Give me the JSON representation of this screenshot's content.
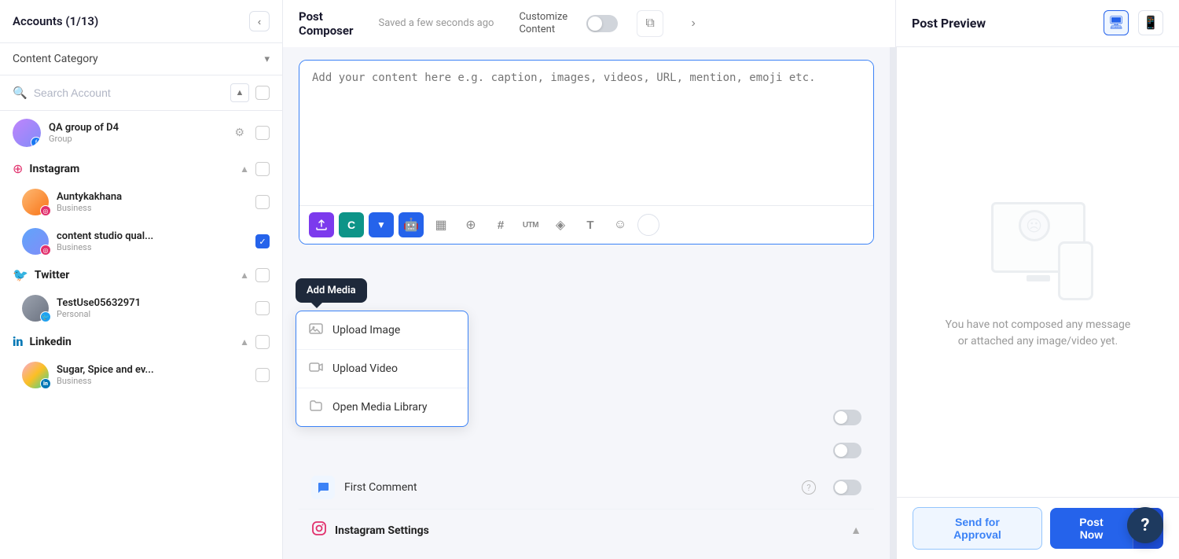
{
  "sidebar": {
    "header_title": "Accounts (1/13)",
    "collapse_icon": "‹",
    "content_category_label": "Content Category",
    "content_category_chevron": "▾",
    "search_placeholder": "Search Account",
    "accounts": [
      {
        "name": "QA group of D4",
        "type": "Group",
        "platform": "facebook",
        "checked": false
      }
    ],
    "platforms": [
      {
        "name": "Instagram",
        "icon": "instagram",
        "collapsed": false,
        "sub_accounts": [
          {
            "name": "Auntykakhana",
            "type": "Business",
            "avatar_style": "orange"
          },
          {
            "name": "content studio qual...",
            "type": "Business",
            "avatar_style": "blue",
            "checked": true
          }
        ]
      },
      {
        "name": "Twitter",
        "icon": "twitter",
        "collapsed": false,
        "sub_accounts": [
          {
            "name": "TestUse05632971",
            "type": "Personal",
            "avatar_style": "gray"
          }
        ]
      },
      {
        "name": "Linkedin",
        "icon": "linkedin",
        "collapsed": false,
        "sub_accounts": [
          {
            "name": "Sugar, Spice and ev...",
            "type": "Business",
            "avatar_style": "colorful"
          }
        ]
      }
    ]
  },
  "composer": {
    "title": "Post\nComposer",
    "saved_status": "Saved a few seconds ago",
    "customize_label": "Customize\nContent",
    "copy_icon": "⧉",
    "next_icon": "›",
    "textarea_placeholder": "Add your content here e.g. caption, images, videos, URL, mention, emoji etc.",
    "toolbar_buttons": [
      {
        "id": "upload",
        "icon": "⬆",
        "style": "purple",
        "label": "Upload Media"
      },
      {
        "id": "content",
        "icon": "C",
        "style": "teal",
        "label": "Content"
      },
      {
        "id": "dropdown",
        "icon": "▼",
        "style": "blue",
        "label": "Dropdown"
      },
      {
        "id": "robot",
        "icon": "🤖",
        "style": "robot",
        "label": "Robot"
      },
      {
        "id": "grid",
        "icon": "▦",
        "style": "gray",
        "label": "Grid"
      },
      {
        "id": "location",
        "icon": "⊕",
        "style": "gray",
        "label": "Location"
      },
      {
        "id": "hashtag",
        "icon": "#",
        "style": "gray",
        "label": "Hashtag"
      },
      {
        "id": "utm",
        "icon": "UTM",
        "style": "gray",
        "label": "UTM"
      },
      {
        "id": "embed",
        "icon": "◈",
        "style": "gray",
        "label": "Embed"
      },
      {
        "id": "text",
        "icon": "T",
        "style": "gray",
        "label": "Text"
      },
      {
        "id": "emoji",
        "icon": "☺",
        "style": "gray",
        "label": "Emoji"
      },
      {
        "id": "circle",
        "icon": "",
        "style": "circle-empty",
        "label": "More"
      }
    ],
    "add_media_tooltip": "Add Media",
    "media_dropdown": {
      "items": [
        {
          "id": "upload-image",
          "icon": "🖼",
          "label": "Upload Image"
        },
        {
          "id": "upload-video",
          "icon": "🎬",
          "label": "Upload Video"
        },
        {
          "id": "open-media-library",
          "icon": "📁",
          "label": "Open Media Library"
        }
      ]
    },
    "options": [
      {
        "id": "first-comment",
        "icon": "💬",
        "icon_style": "blue-bg",
        "label": "First Comment",
        "has_help": true,
        "toggle_on": false
      }
    ],
    "instagram_settings": {
      "title": "Instagram Settings",
      "icon": "instagram",
      "expanded": true
    }
  },
  "preview": {
    "title": "Post Preview",
    "desktop_icon": "🖥",
    "mobile_icon": "📱",
    "empty_text": "You have not composed any message or attached any image/video yet."
  },
  "bottom_bar": {
    "send_approval_label": "Send for Approval",
    "post_now_label": "Post Now",
    "post_arrow": "▲"
  },
  "help": {
    "label": "?"
  }
}
